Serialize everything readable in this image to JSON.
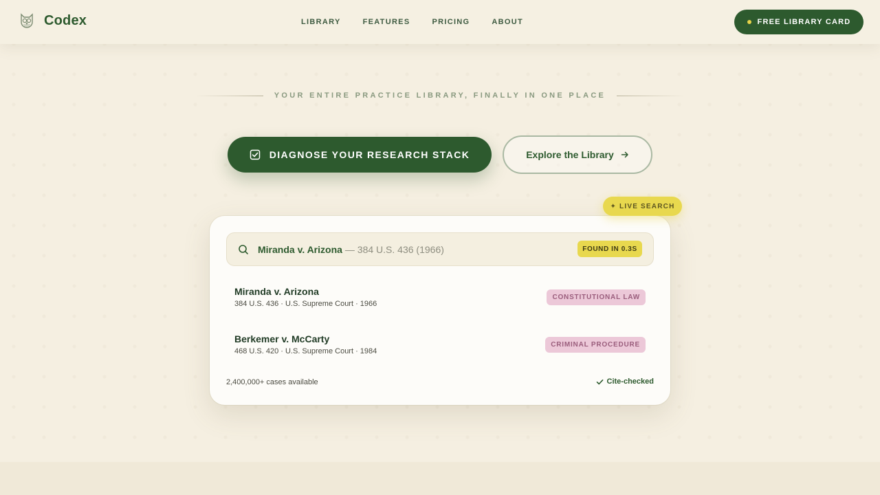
{
  "header": {
    "brand_name": "Codex",
    "nav": [
      "LIBRARY",
      "FEATURES",
      "PRICING",
      "ABOUT"
    ],
    "cta_label": "FREE LIBRARY CARD"
  },
  "hero": {
    "tagline": "YOUR ENTIRE PRACTICE LIBRARY, FINALLY IN ONE PLACE",
    "primary_button": "DIAGNOSE YOUR RESEARCH STACK",
    "secondary_button": "Explore the Library"
  },
  "search_card": {
    "live_badge": "✦ LIVE SEARCH",
    "query": "Miranda v. Arizona",
    "query_citation": "— 384 U.S. 436 (1966)",
    "found_badge": "FOUND IN 0.3S",
    "results": [
      {
        "title": "Miranda v. Arizona",
        "meta": "384 U.S. 436 · U.S. Supreme Court · 1966",
        "tag": "CONSTITUTIONAL LAW"
      },
      {
        "title": "Berkemer v. McCarty",
        "meta": "468 U.S. 420 · U.S. Supreme Court · 1984",
        "tag": "CRIMINAL PROCEDURE"
      }
    ],
    "footer_count": "2,400,000+ cases available",
    "footer_status": "Cite-checked"
  },
  "colors": {
    "background": "#f5efe1",
    "primary_green": "#2d5a2e",
    "accent_yellow": "#e8d84e",
    "tag_pink": "#ecc8d8",
    "tag_pink_text": "#9a5d7c"
  },
  "icons": {
    "brand": "owl-logo-icon",
    "primary_button": "checkbox-icon",
    "secondary_button": "arrow-right-icon",
    "search": "search-icon",
    "status": "check-icon"
  }
}
